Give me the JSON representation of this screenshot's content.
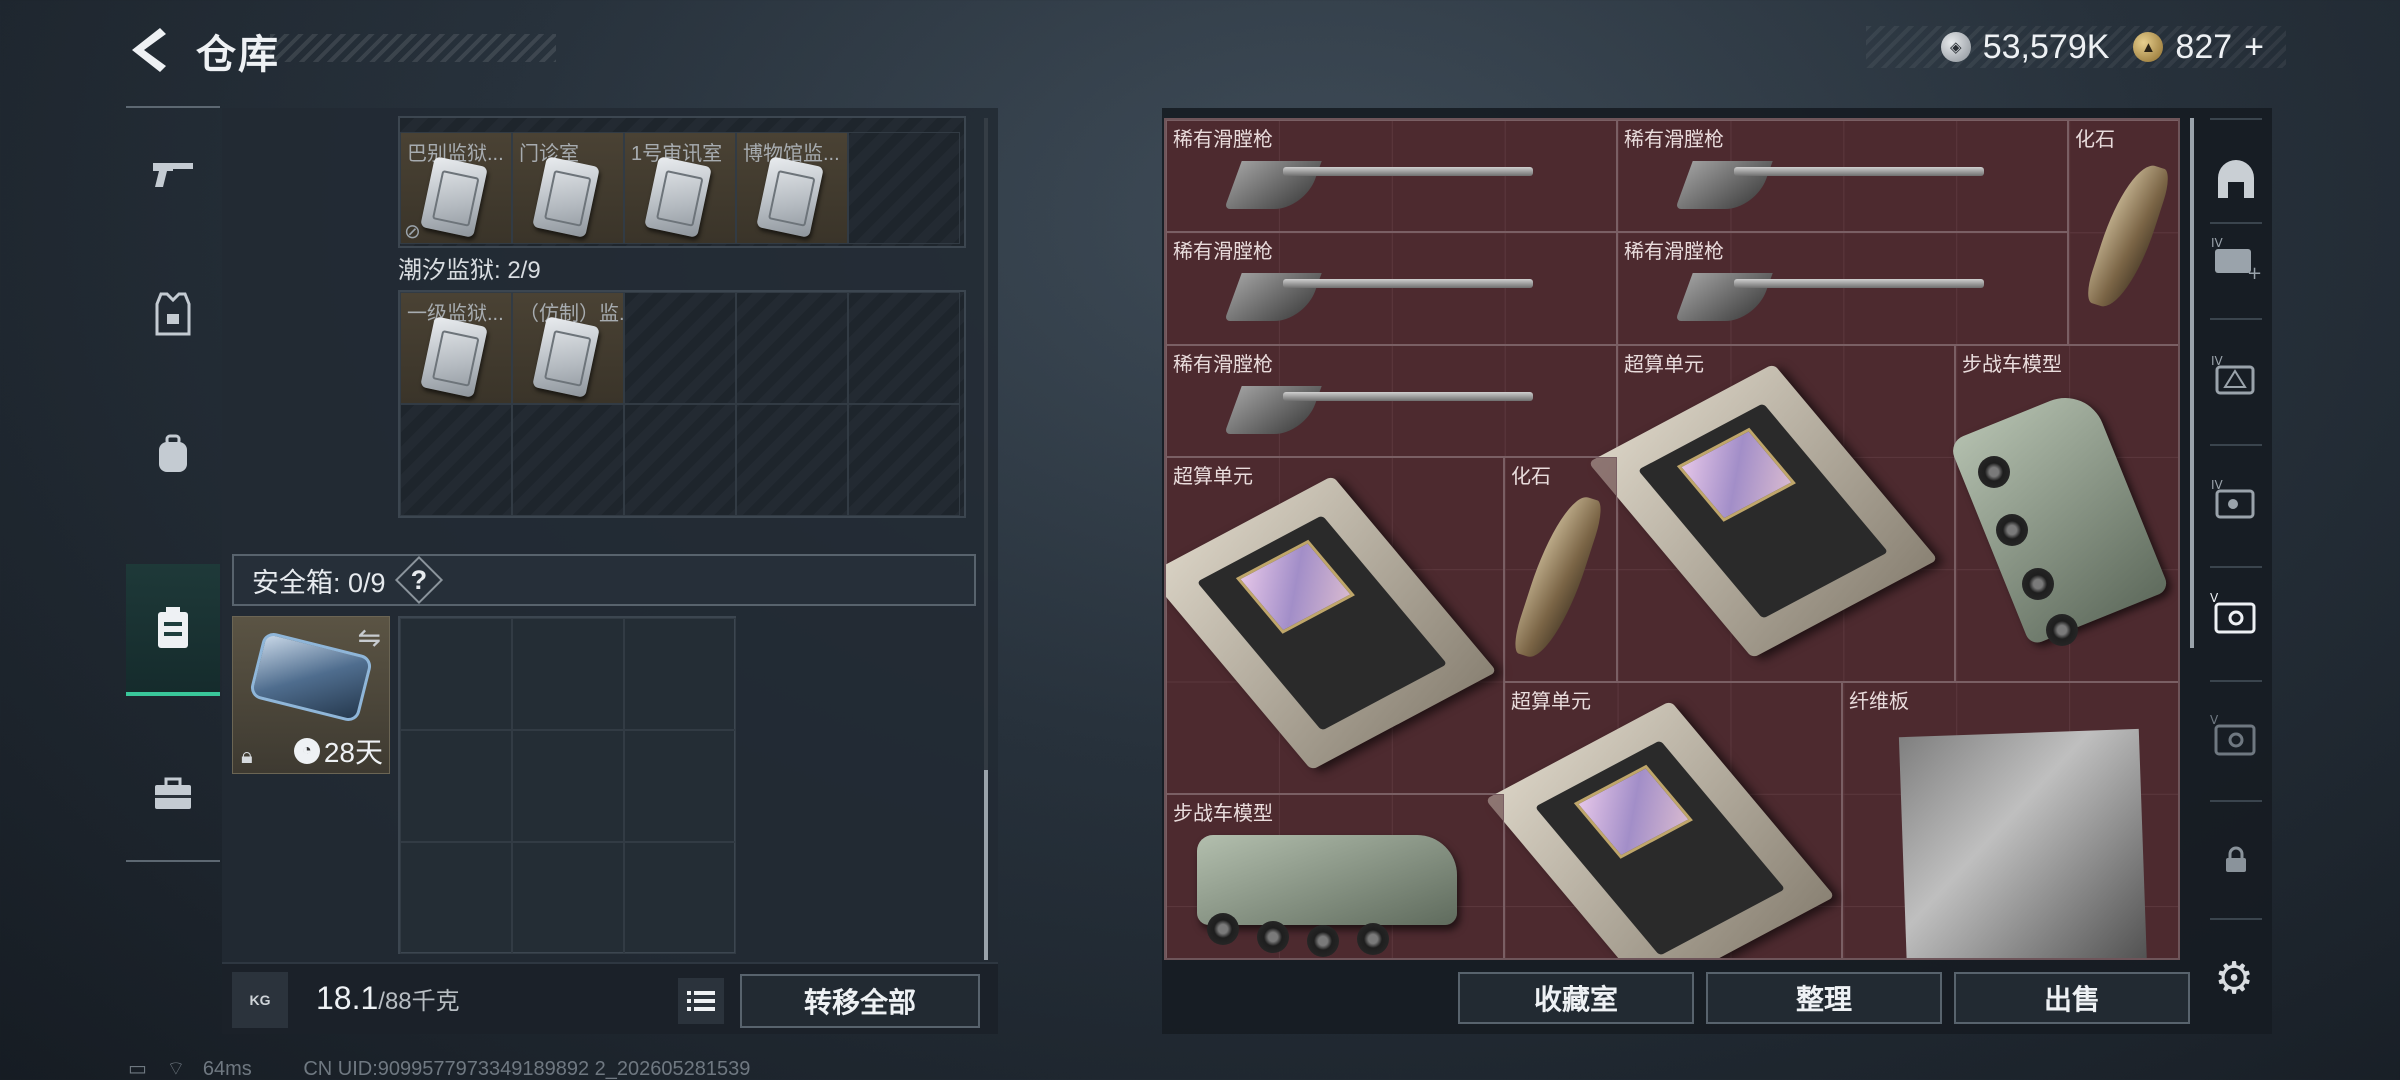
{
  "header": {
    "title": "仓库",
    "currency": [
      {
        "icon": "silver-coin-icon",
        "value": "53,579K"
      },
      {
        "icon": "gold-coin-icon",
        "value": "827"
      }
    ],
    "add_label": "+"
  },
  "left_rail": {
    "items": [
      {
        "icon": "gun-icon",
        "active": false
      },
      {
        "icon": "armor-vest-icon",
        "active": false
      },
      {
        "icon": "backpack-icon",
        "active": false
      },
      {
        "icon": "safe-box-icon",
        "active": true
      },
      {
        "icon": "toolbox-icon",
        "active": false
      }
    ]
  },
  "containers": {
    "top_box": {
      "items": [
        {
          "label": "巴别监狱..."
        },
        {
          "label": "门诊室"
        },
        {
          "label": "1号审讯室"
        },
        {
          "label": "博物馆监..."
        }
      ]
    },
    "prison": {
      "title": "潮汐监狱: 2/9",
      "items": [
        {
          "label": "一级监狱..."
        },
        {
          "label": "（仿制）监..."
        }
      ]
    },
    "safe": {
      "label": "安全箱: 0/9",
      "help": "?",
      "timer": "28天"
    }
  },
  "bottom_left": {
    "weight_current": "18.1",
    "weight_max": "/88千克",
    "kg_label": "KG",
    "transfer_all": "转移全部"
  },
  "status_line": {
    "ping": "64ms",
    "uid": "CN UID:9099577973349189892 2_202605281539"
  },
  "stash": {
    "items": [
      {
        "name": "稀有滑膛枪",
        "kind": "gun"
      },
      {
        "name": "稀有滑膛枪",
        "kind": "gun"
      },
      {
        "name": "化石",
        "kind": "fossil"
      },
      {
        "name": "稀有滑膛枪",
        "kind": "gun"
      },
      {
        "name": "稀有滑膛枪",
        "kind": "gun"
      },
      {
        "name": "稀有滑膛枪",
        "kind": "gun"
      },
      {
        "name": "超算单元",
        "kind": "chip"
      },
      {
        "name": "步战车模型",
        "kind": "ifv"
      },
      {
        "name": "超算单元",
        "kind": "chip"
      },
      {
        "name": "化石",
        "kind": "fossil"
      },
      {
        "name": "超算单元",
        "kind": "chip"
      },
      {
        "name": "纤维板",
        "kind": "fiber"
      },
      {
        "name": "步战车模型",
        "kind": "ifv"
      }
    ]
  },
  "bottom_right": {
    "collection": "收藏室",
    "sort": "整理",
    "sell": "出售"
  },
  "right_rail": {
    "items": [
      {
        "icon": "helmet-icon"
      },
      {
        "icon": "add-card-icon",
        "tier": "IV"
      },
      {
        "icon": "warning-card-icon",
        "tier": "IV"
      },
      {
        "icon": "key-card-icon",
        "tier": "IV"
      },
      {
        "icon": "selected-card-icon",
        "tier": "V"
      },
      {
        "icon": "card-icon",
        "tier": "V"
      },
      {
        "icon": "lock-icon"
      }
    ]
  },
  "colors": {
    "accent": "#39c79a",
    "stash_bg": "#4a2a2f"
  }
}
